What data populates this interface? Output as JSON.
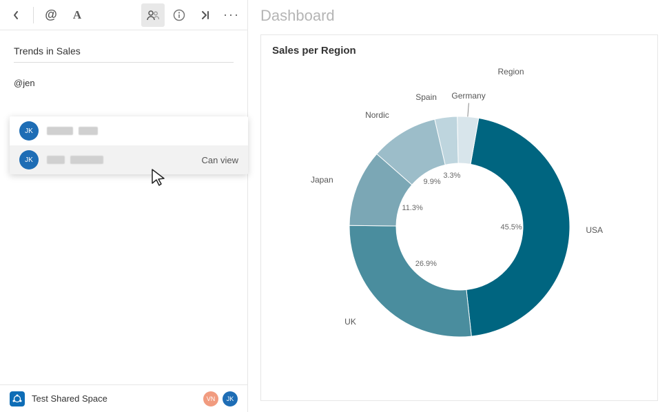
{
  "toolbar": {
    "back_label": "‹",
    "mention_label": "@",
    "text_label": "A",
    "people_label": "people",
    "info_label": "i",
    "goto_label": "›|",
    "more_label": "···"
  },
  "panel": {
    "section_title": "Trends in Sales",
    "mention_text": "@jen"
  },
  "suggestions": {
    "items": [
      {
        "initials": "JK",
        "permission": ""
      },
      {
        "initials": "JK",
        "permission": "Can view"
      }
    ]
  },
  "footer": {
    "space_name": "Test Shared Space",
    "avatars": [
      {
        "initials": "VN",
        "cls": "av-vn"
      },
      {
        "initials": "JK",
        "cls": "av-jk"
      }
    ]
  },
  "dashboard": {
    "title": "Dashboard"
  },
  "chart_title": "Sales per Region",
  "legend_title": "Region",
  "chart_data": {
    "type": "pie",
    "title": "Sales per Region",
    "legend_title": "Region",
    "series": [
      {
        "name": "USA",
        "value": 45.5,
        "color": "#006580"
      },
      {
        "name": "UK",
        "value": 26.9,
        "color": "#4a8d9e"
      },
      {
        "name": "Japan",
        "value": 11.3,
        "color": "#7ba7b5"
      },
      {
        "name": "Nordic",
        "value": 9.9,
        "color": "#9cbdc9"
      },
      {
        "name": "Spain",
        "value": 3.3,
        "color": "#bed5de"
      },
      {
        "name": "Germany",
        "value": 3.1,
        "color": "#d8e5eb"
      }
    ]
  }
}
